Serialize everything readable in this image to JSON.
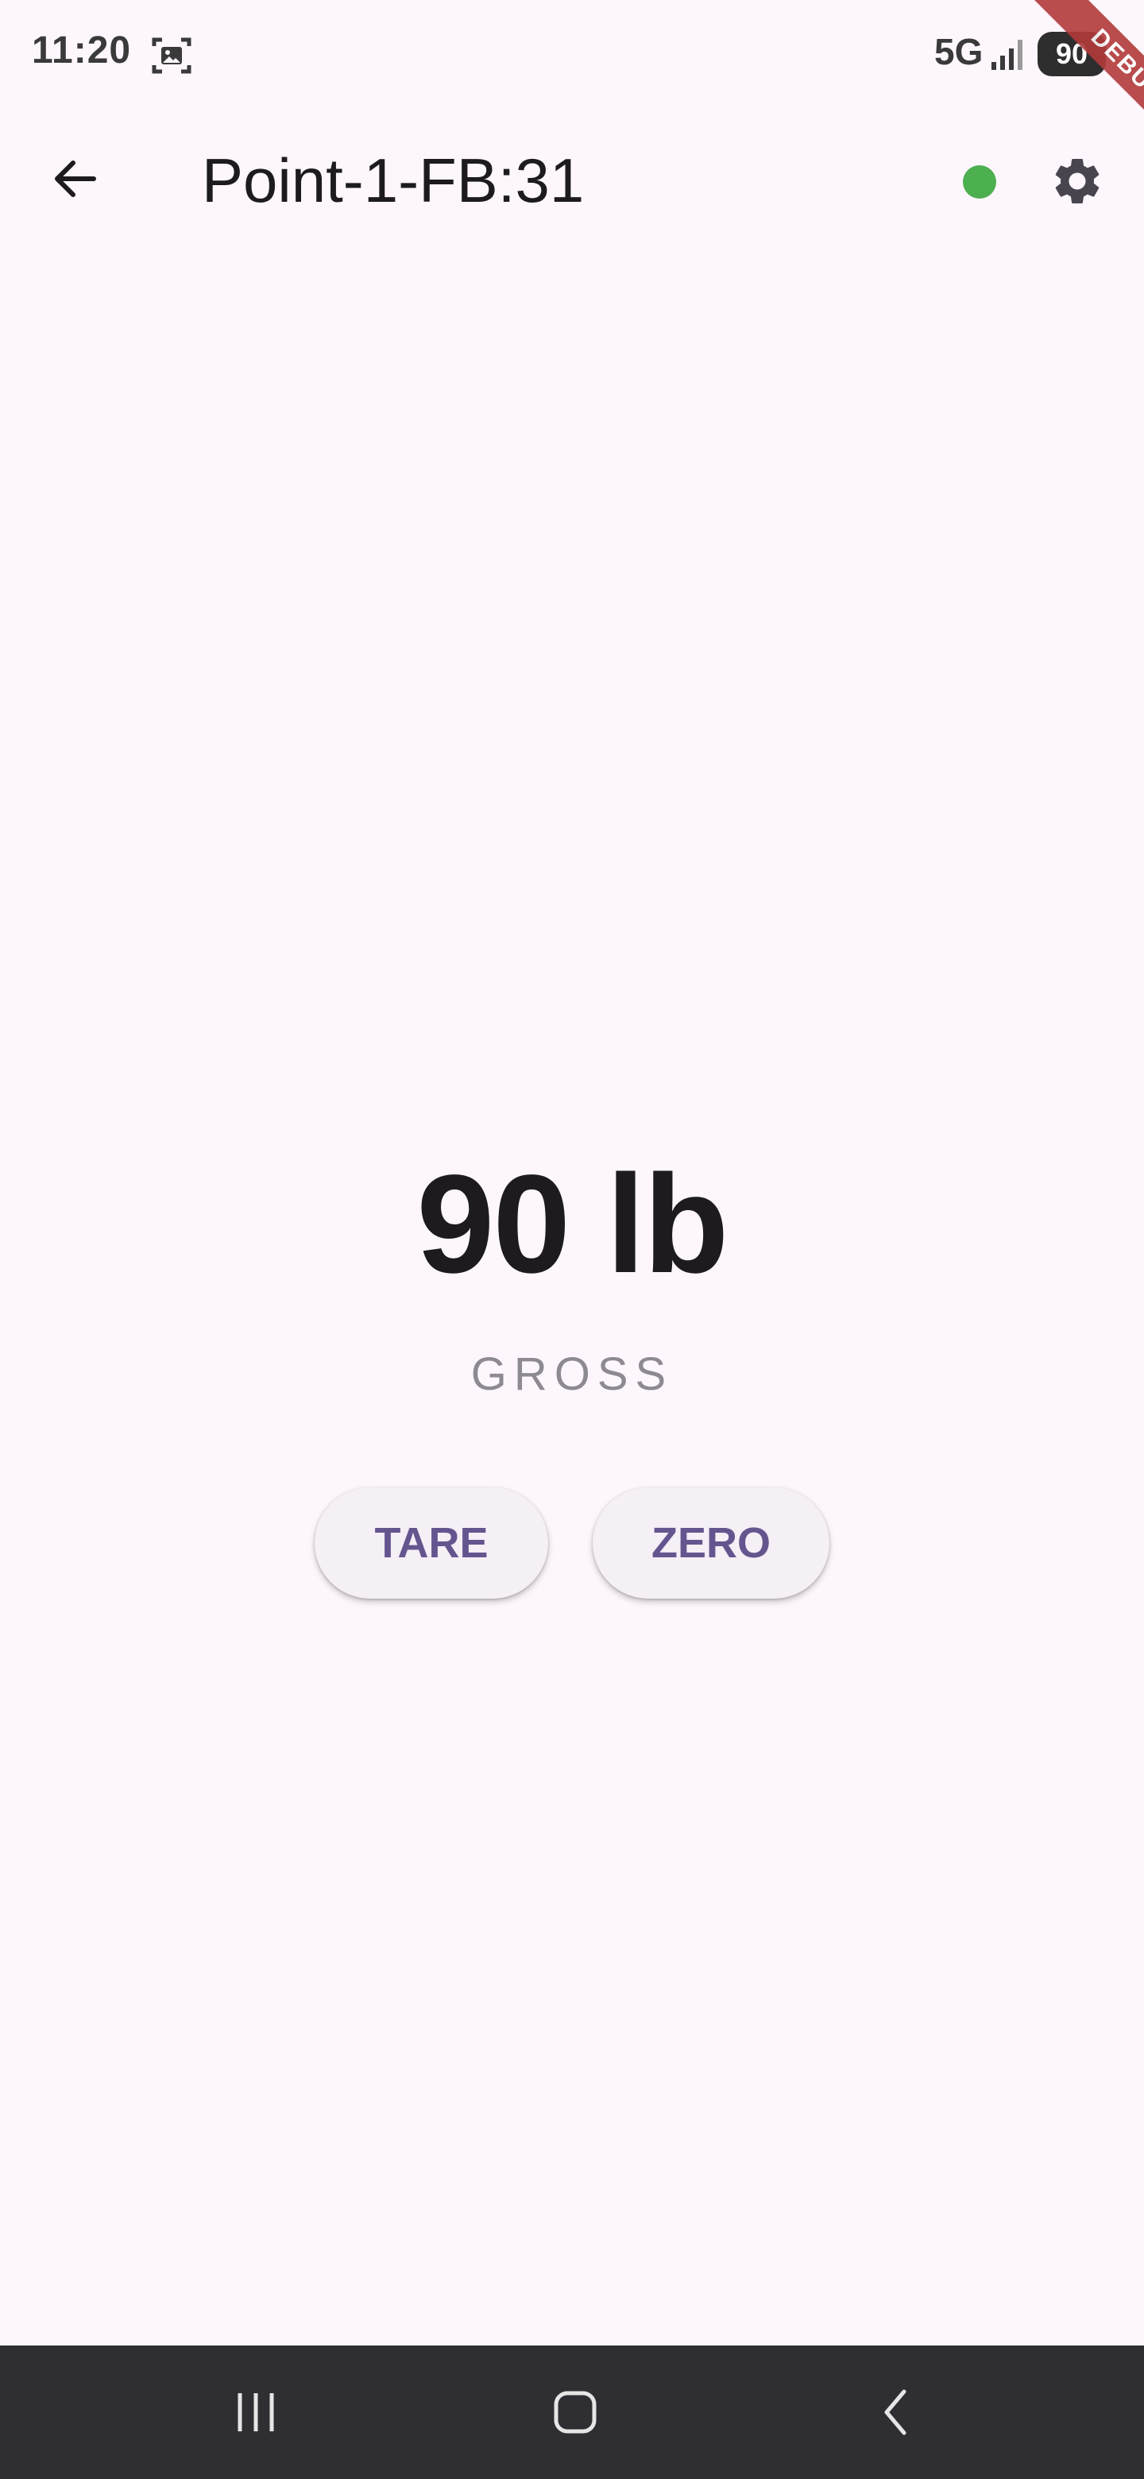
{
  "status_bar": {
    "time": "11:20",
    "network": "5G",
    "battery": "90",
    "icons": [
      "screenshot-icon",
      "signal-icon",
      "battery-icon"
    ]
  },
  "debug_banner": {
    "label": "DEBUG"
  },
  "app_bar": {
    "title": "Point-1-FB:31",
    "connection_status_color": "#4caf50",
    "icons": [
      "back-arrow-icon",
      "gear-icon"
    ]
  },
  "scale": {
    "weight": "90 lb",
    "mode": "GROSS"
  },
  "actions": {
    "tare_label": "TARE",
    "zero_label": "ZERO"
  },
  "nav_bar": {
    "icons": [
      "recents-icon",
      "home-icon",
      "back-icon"
    ]
  },
  "colors": {
    "background": "#fdf7fd",
    "accent": "#65558f",
    "nav_bar": "#2f2e33"
  }
}
